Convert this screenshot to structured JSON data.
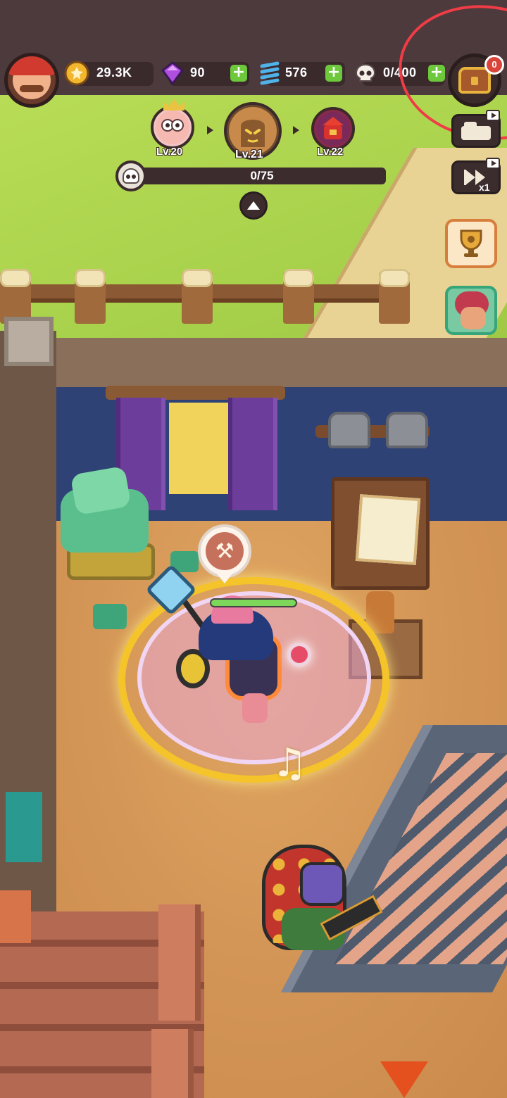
{
  "hud": {
    "coins": {
      "value": "29.3K",
      "icon": "gold-coin-icon"
    },
    "gems": {
      "value": "90",
      "icon": "purple-gem-icon"
    },
    "energy": {
      "value": "576",
      "icon": "blue-spring-icon"
    },
    "kills": {
      "value": "0/400",
      "icon": "skull-icon"
    },
    "chest_badge": "0"
  },
  "waves": {
    "nodes": [
      {
        "level": "Lv.20",
        "icon": "pink-monster-icon"
      },
      {
        "level": "Lv.21",
        "icon": "tree-monster-icon",
        "current": true
      },
      {
        "level": "Lv.22",
        "icon": "red-lantern-boss-icon"
      }
    ],
    "progress_text": "0/75",
    "progress_fraction": 0.0
  },
  "side": {
    "speed_label": "x1"
  },
  "player": {
    "hp_fraction": 1.0,
    "skill_icon": "pickaxe-icon"
  },
  "colors": {
    "hud_band": "#4c3a3c",
    "plus_green": "#6dc83c",
    "annotation_red": "#ef3c46",
    "aura_gold": "#f4c42a",
    "grass": "#b8dc55"
  }
}
